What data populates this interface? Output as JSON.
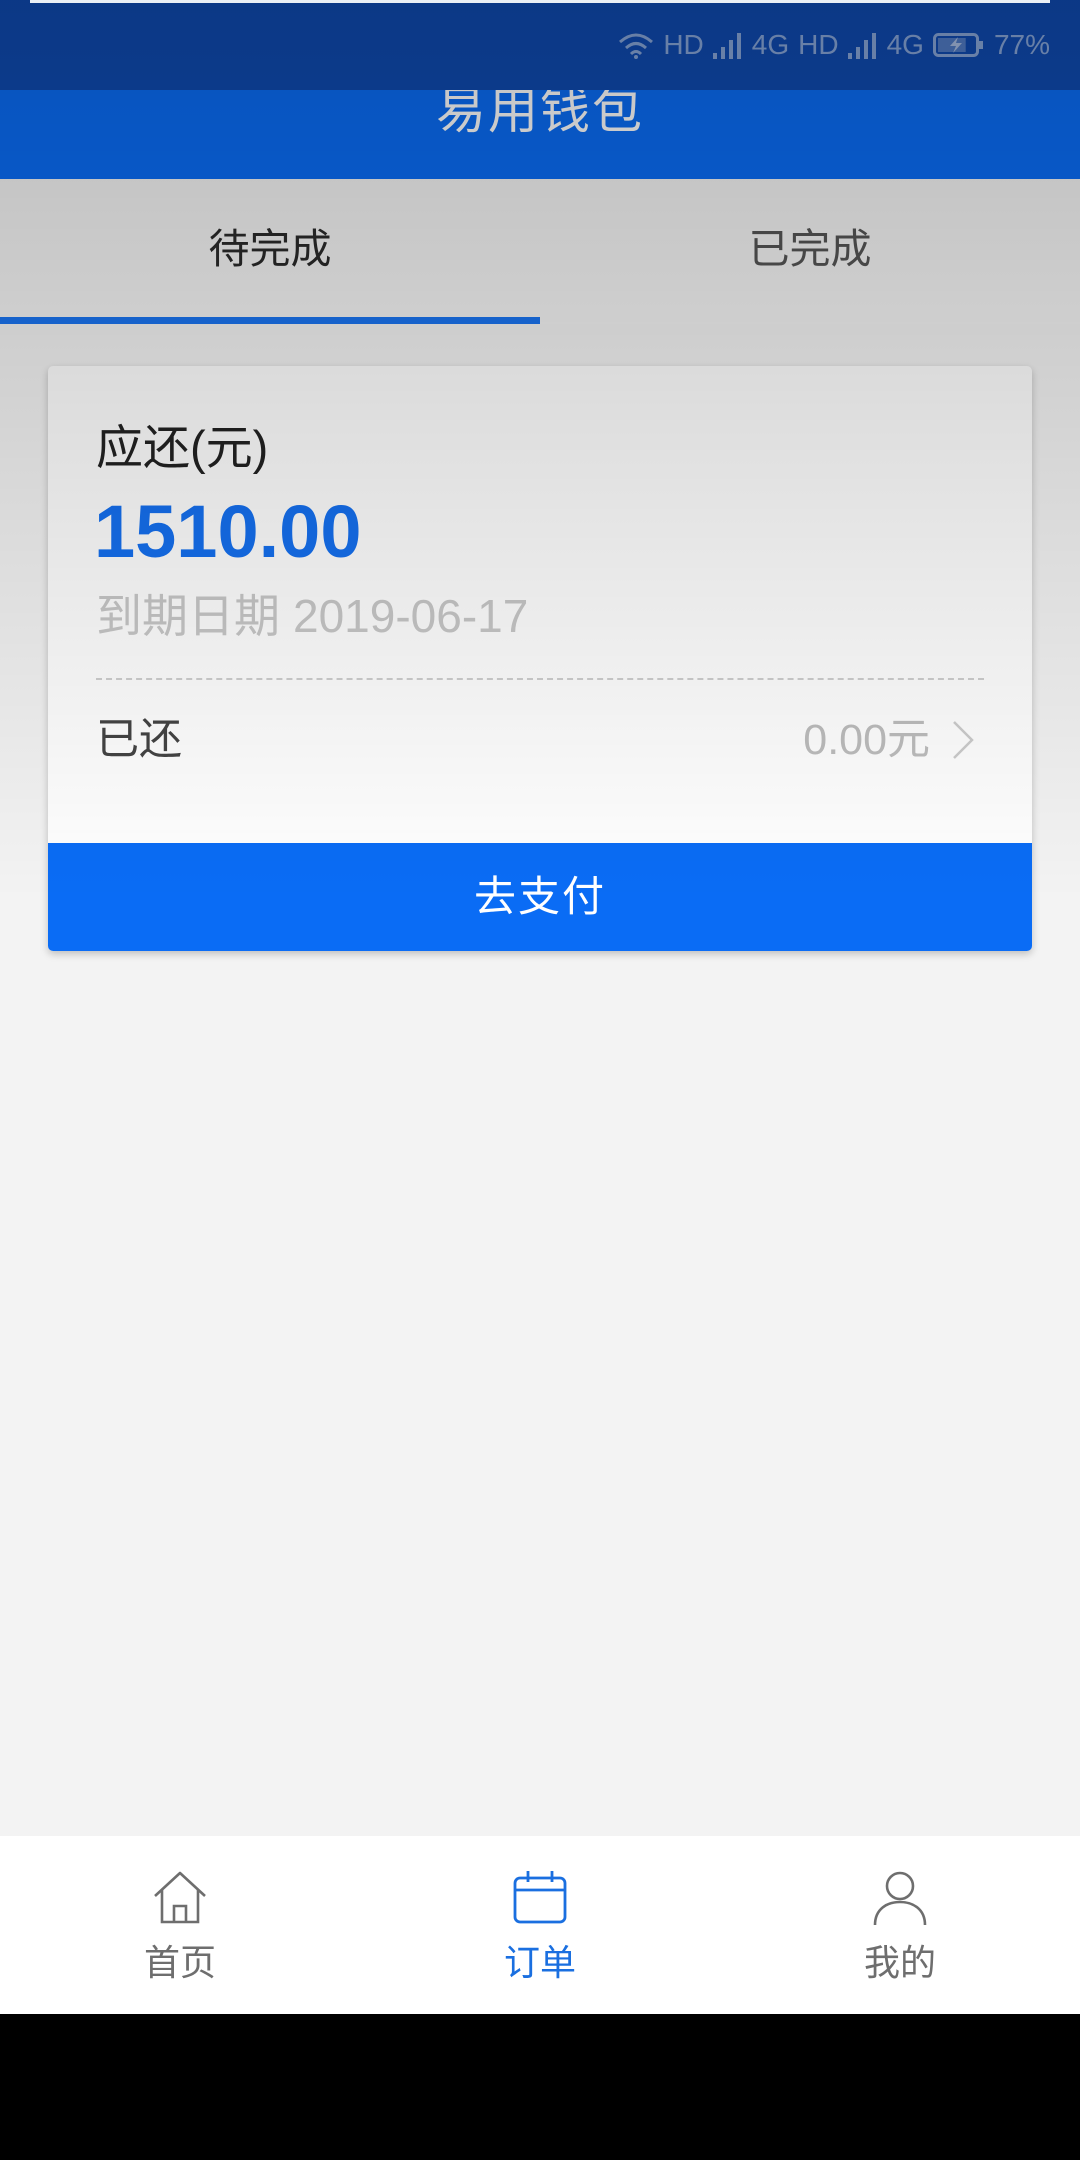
{
  "status_bar": {
    "network": [
      "HD",
      "4G",
      "HD",
      "4G"
    ],
    "battery": "77%",
    "icons": [
      "wifi-icon",
      "signal-icon",
      "signal-icon",
      "battery-icon"
    ]
  },
  "header": {
    "title": "易用钱包"
  },
  "tabs": [
    {
      "label": "待完成",
      "active": true
    },
    {
      "label": "已完成",
      "active": false
    }
  ],
  "order_card": {
    "due_label": "应还(元)",
    "due_amount": "1510.00",
    "due_date_label": "到期日期",
    "due_date": "2019-06-17",
    "repaid_label": "已还",
    "repaid_amount": "0.00元",
    "pay_button": "去支付"
  },
  "bottom_nav": [
    {
      "label": "首页",
      "icon": "home-icon",
      "active": false
    },
    {
      "label": "订单",
      "icon": "calendar-icon",
      "active": true
    },
    {
      "label": "我的",
      "icon": "user-icon",
      "active": false
    }
  ],
  "colors": {
    "accent": "#0a6cf5",
    "amount": "#1570f0",
    "active_nav": "#1a6fe0",
    "background": "#f3f3f3"
  }
}
